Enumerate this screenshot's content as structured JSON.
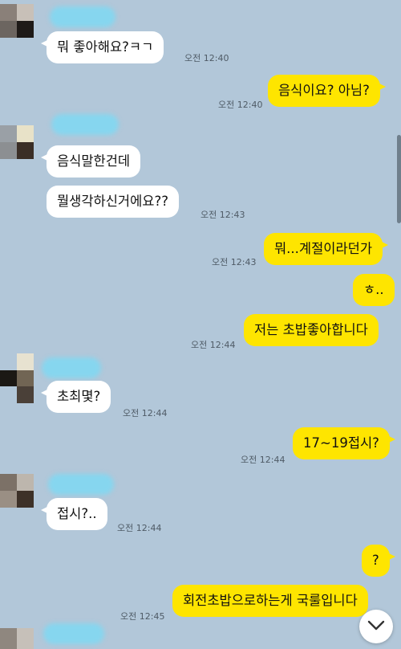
{
  "messages": {
    "m1": {
      "text": "뭐 좋아해요?ㅋㄱ",
      "time": "오전 12:40"
    },
    "m2": {
      "text": "음식이요? 아님?",
      "time": "오전 12:40"
    },
    "m3": {
      "text": "음식말한건데"
    },
    "m4": {
      "text": "뭘생각하신거에요??",
      "time": "오전 12:43"
    },
    "m5": {
      "text": "뭐...계절이라던가",
      "time": "오전 12:43"
    },
    "m6": {
      "text": "ㅎ.."
    },
    "m7": {
      "text": "저는 초밥좋아합니다",
      "time": "오전 12:44"
    },
    "m8": {
      "text": "초최몇?",
      "time": "오전 12:44"
    },
    "m9": {
      "text": "17~19접시?",
      "time": "오전 12:44"
    },
    "m10": {
      "text": "접시?..",
      "time": "오전 12:44"
    },
    "m11": {
      "text": "?"
    },
    "m12": {
      "text": "회전초밥으로하는게 국룰입니다",
      "time": "오전 12:45"
    }
  },
  "colors": {
    "background": "#b2c7d9",
    "outgoing_bubble": "#fee500",
    "incoming_bubble": "#ffffff",
    "name_blur": "#86d6ef"
  },
  "icons": {
    "scroll_down": "chevron-down-icon",
    "avatar": "pixelated-avatar"
  }
}
